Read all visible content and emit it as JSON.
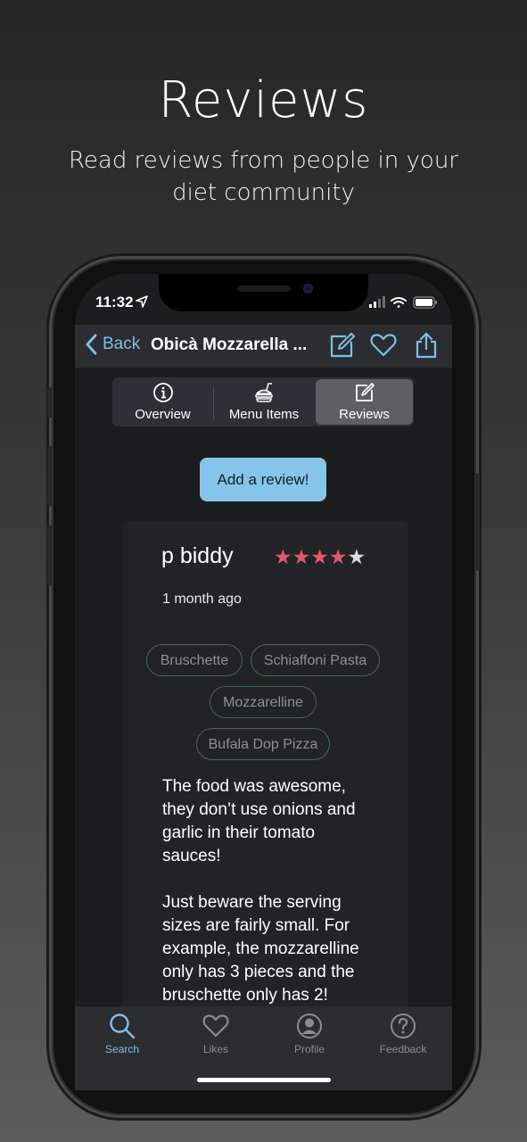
{
  "promo": {
    "title": "Reviews",
    "subtitle": "Read reviews from people in your diet community"
  },
  "status_bar": {
    "time": "11:32"
  },
  "navbar": {
    "back_label": "Back",
    "title": "Obicà Mozzarella ..."
  },
  "segments": [
    {
      "label": "Overview",
      "icon": "info-icon"
    },
    {
      "label": "Menu Items",
      "icon": "food-icon"
    },
    {
      "label": "Reviews",
      "icon": "edit-icon",
      "selected": true
    }
  ],
  "add_review_label": "Add a review!",
  "review": {
    "reviewer": "p biddy",
    "rating": 4,
    "rating_max": 5,
    "time_ago": "1 month ago",
    "dishes": [
      "Bruschette",
      "Schiaffoni Pasta",
      "Mozzarelline",
      "Bufala Dop Pizza"
    ],
    "paragraphs": [
      "The food was awesome, they don’t use onions and garlic in their tomato sauces!",
      "Just beware the serving sizes are fairly small. For example, the mozzarelline only has 3 pieces and the bruschette only has 2!"
    ]
  },
  "tabbar": [
    {
      "label": "Search",
      "icon": "search-icon",
      "active": true
    },
    {
      "label": "Likes",
      "icon": "heart-icon"
    },
    {
      "label": "Profile",
      "icon": "profile-icon"
    },
    {
      "label": "Feedback",
      "icon": "question-icon"
    }
  ],
  "colors": {
    "accent": "#7dbfe6",
    "button": "#86c5e9",
    "star_on": "#e6576a",
    "chip_border": "#3f6b4c"
  }
}
